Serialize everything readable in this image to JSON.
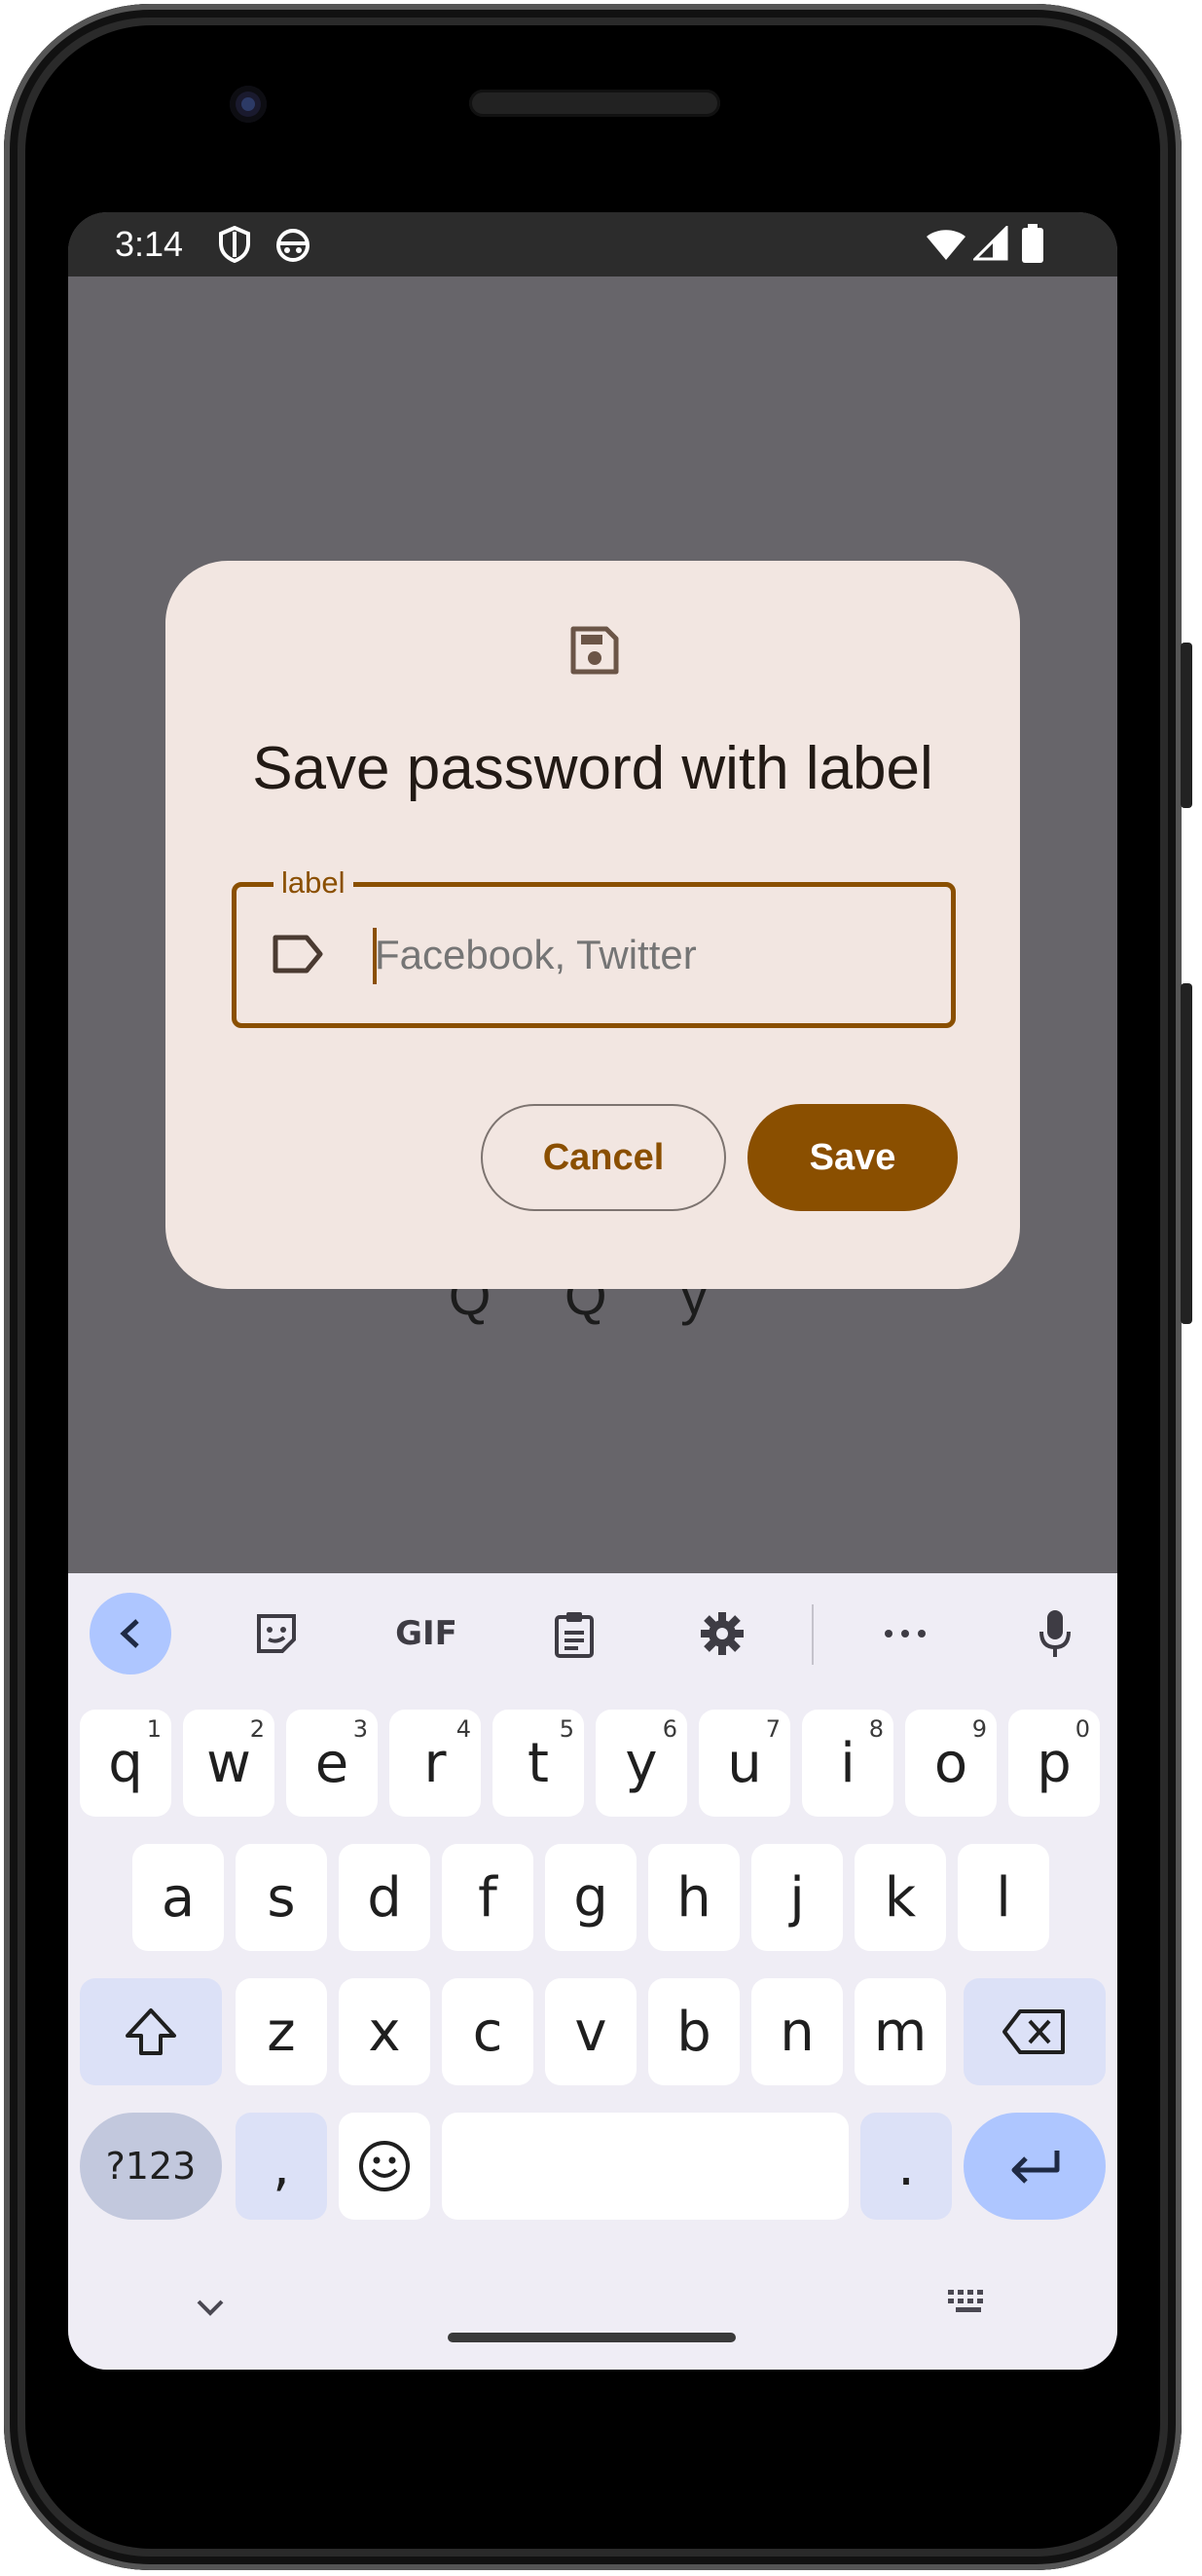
{
  "status_bar": {
    "time": "3:14",
    "icons": [
      "shield-icon",
      "android-icon",
      "wifi-icon",
      "signal-icon",
      "battery-icon"
    ]
  },
  "background": {
    "obscured_text": "Q Q y"
  },
  "dialog": {
    "icon": "save-icon",
    "title": "Save password with label",
    "field": {
      "label": "label",
      "leading_icon": "label-tag-icon",
      "placeholder": "Facebook, Twitter",
      "value": ""
    },
    "cancel_label": "Cancel",
    "save_label": "Save"
  },
  "keyboard": {
    "toolbar": [
      "back-icon",
      "sticker-icon",
      "GIF",
      "clipboard-icon",
      "settings-icon",
      "more-icon",
      "mic-icon"
    ],
    "row1": [
      {
        "key": "q",
        "hint": "1"
      },
      {
        "key": "w",
        "hint": "2"
      },
      {
        "key": "e",
        "hint": "3"
      },
      {
        "key": "r",
        "hint": "4"
      },
      {
        "key": "t",
        "hint": "5"
      },
      {
        "key": "y",
        "hint": "6"
      },
      {
        "key": "u",
        "hint": "7"
      },
      {
        "key": "i",
        "hint": "8"
      },
      {
        "key": "o",
        "hint": "9"
      },
      {
        "key": "p",
        "hint": "0"
      }
    ],
    "row2": [
      "a",
      "s",
      "d",
      "f",
      "g",
      "h",
      "j",
      "k",
      "l"
    ],
    "row3": [
      "z",
      "x",
      "c",
      "v",
      "b",
      "n",
      "m"
    ],
    "row4": {
      "symbols": "?123",
      "comma": ",",
      "period": "."
    }
  },
  "colors": {
    "accent": "#8a4f00",
    "dialog_bg": "#f2e6e1",
    "scrim": "#67656a",
    "keyboard_bg": "#efedf5",
    "enter_key": "#aec6ff"
  }
}
